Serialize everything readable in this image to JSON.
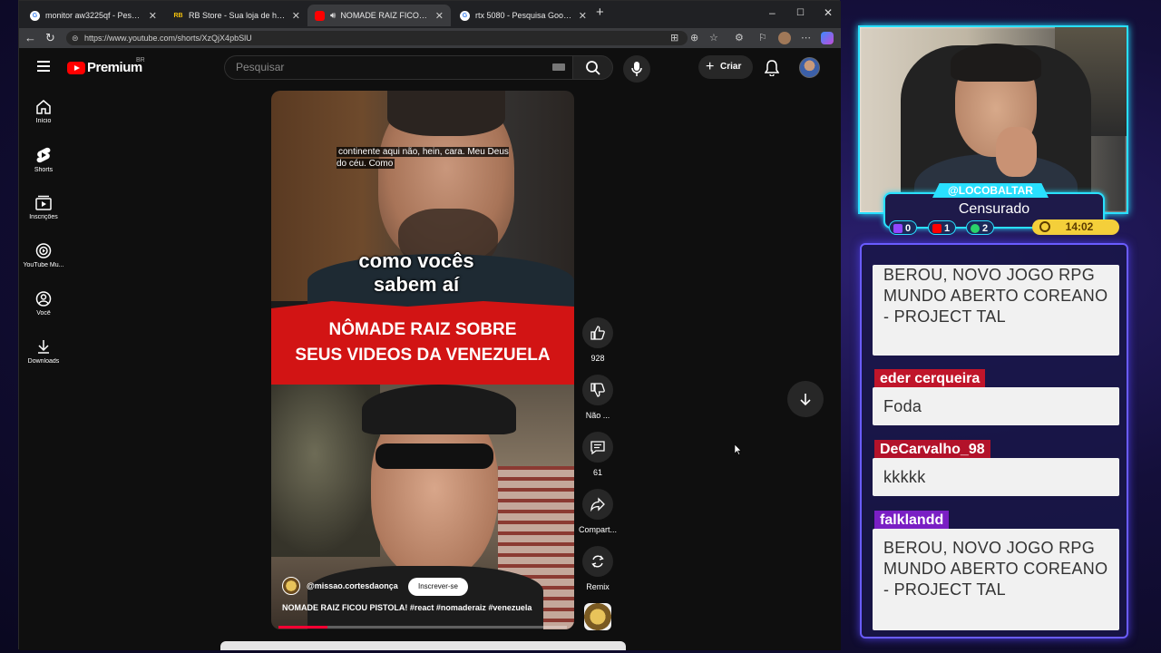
{
  "browser": {
    "tabs": [
      {
        "title": "monitor aw3225qf - Pesquisa Goo",
        "favicon": "G"
      },
      {
        "title": "RB Store - Sua loja de hardware",
        "favicon": "RB"
      },
      {
        "title": "NOMADE RAIZ FICOU PISTO",
        "favicon": "YT"
      },
      {
        "title": "rtx 5080 - Pesquisa Google",
        "favicon": "G"
      }
    ],
    "new_tab": "+",
    "url": "https://www.youtube.com/shorts/XzQjX4pbSlU",
    "window_controls": {
      "minimize": "–",
      "maximize": "☐",
      "close": "✕"
    }
  },
  "youtube": {
    "brand": "Premium",
    "region": "BR",
    "search_placeholder": "Pesquisar",
    "create_label": "Criar",
    "sidebar": [
      {
        "label": "Início",
        "icon": "home-icon"
      },
      {
        "label": "Shorts",
        "icon": "shorts-icon"
      },
      {
        "label": "Inscrições",
        "icon": "subscriptions-icon"
      },
      {
        "label": "YouTube Mu...",
        "icon": "youtube-music-icon"
      },
      {
        "label": "Você",
        "icon": "you-icon"
      },
      {
        "label": "Downloads",
        "icon": "download-icon"
      }
    ],
    "short": {
      "subtitle": "continente aqui não, hein, cara. Meu Deus do céu. Como",
      "banner_line1": "NÔMADE RAIZ SOBRE",
      "banner_line2": "SEUS VIDEOS DA VENEZUELA",
      "caption": "como vocês sabem aí",
      "channel": "@missao.cortesdaonça",
      "subscribe": "Inscrever-se",
      "title": "NOMADE RAIZ FICOU PISTOLA! #react #nomaderaiz #venezuela",
      "progress": 0.17
    },
    "actions": {
      "likes": "928",
      "dislike": "Não ...",
      "comments": "61",
      "share": "Compart...",
      "remix": "Remix"
    }
  },
  "overlay": {
    "handle": "@LOCOBALTAR",
    "status": "Censurado",
    "counts": {
      "twitch": "0",
      "youtube": "1",
      "kick": "2"
    },
    "timer": "14:02",
    "accent_color": "#29e0ff",
    "chat": [
      {
        "user": "",
        "color": "",
        "text": "BEROU, NOVO JOGO RPG MUNDO ABERTO COREANO - PROJECT TAL"
      },
      {
        "user": "eder cerqueira",
        "color": "#c0152a",
        "text": "Foda"
      },
      {
        "user": "DeCarvalho_98",
        "color": "#b3122a",
        "text": "kkkkk"
      },
      {
        "user": "falklandd",
        "color": "#7a1fc4",
        "text": "BEROU, NOVO JOGO RPG MUNDO ABERTO COREANO - PROJECT TAL"
      }
    ]
  }
}
